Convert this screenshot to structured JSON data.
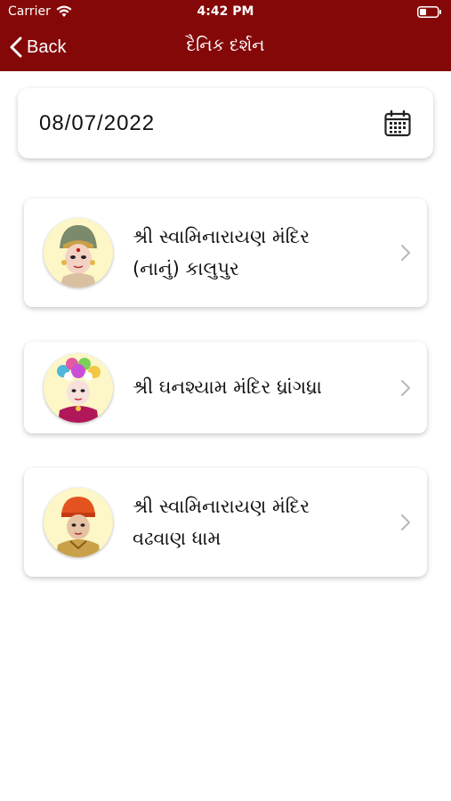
{
  "status_bar": {
    "carrier": "Carrier",
    "time": "4:42 PM"
  },
  "nav": {
    "back_label": "Back",
    "title": "દૈનિક દર્શન"
  },
  "date_field": {
    "value": "08/07/2022",
    "icon": "calendar-icon"
  },
  "temples": [
    {
      "name": "શ્રી સ્વામિનારાયણ મંદિર\n(નાનું) કાલુપુર",
      "icon": "deity-avatar"
    },
    {
      "name": "શ્રી ઘનશ્યામ મંદિર ધ્રાંગધ્રા",
      "icon": "deity-avatar"
    },
    {
      "name": "શ્રી સ્વામિનારાયણ મંદિર\nવઢવાણ ધામ",
      "icon": "deity-avatar"
    }
  ],
  "colors": {
    "header_bg": "#850808",
    "avatar_bg": "#fdf6c6",
    "chevron": "#b8b8b8"
  }
}
